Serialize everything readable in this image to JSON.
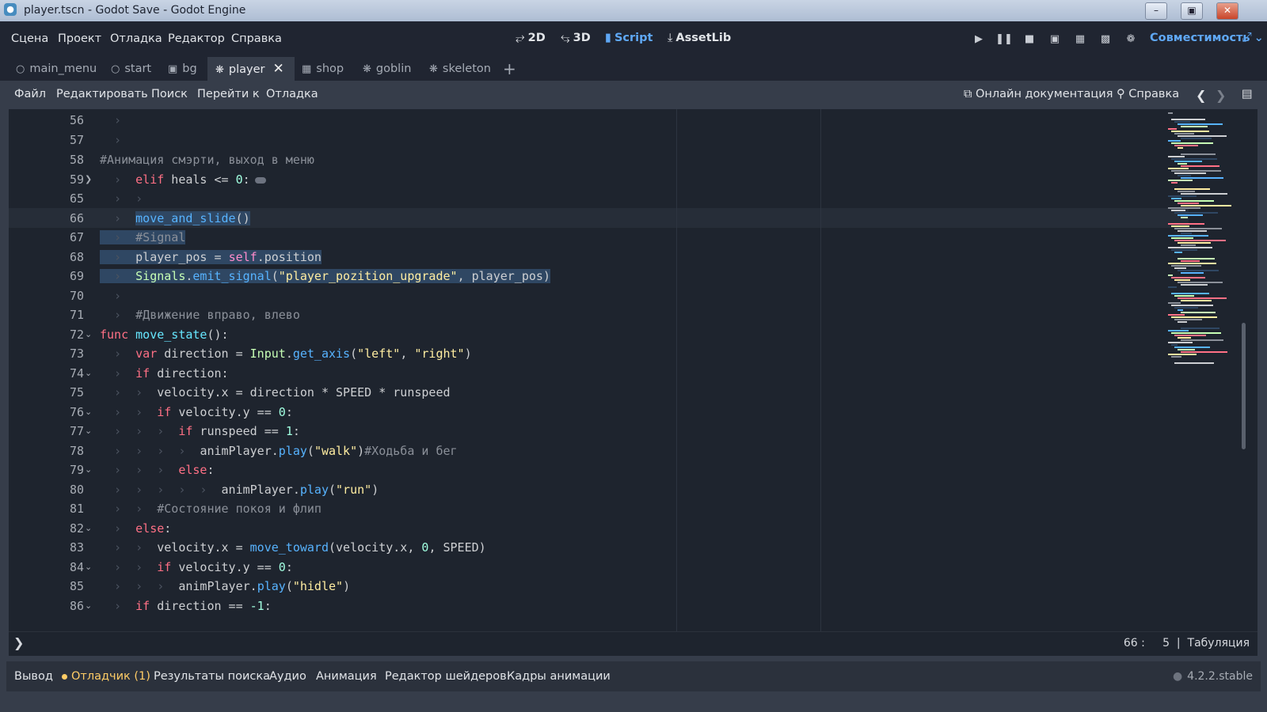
{
  "window": {
    "title": "player.tscn - Godot Save - Godot Engine",
    "controls": [
      "–",
      "▣",
      "✕"
    ]
  },
  "main_menu": [
    "Сцена",
    "Проект",
    "Отладка",
    "Редактор",
    "Справка"
  ],
  "modes": [
    {
      "label": "2D",
      "icon": "2d-icon"
    },
    {
      "label": "3D",
      "icon": "3d-icon"
    },
    {
      "label": "Script",
      "icon": "script-icon",
      "active": true
    },
    {
      "label": "AssetLib",
      "icon": "assetlib-icon"
    }
  ],
  "run_controls": [
    "play-icon",
    "pause-icon",
    "stop-icon",
    "remote-debug-icon",
    "play-scene-icon",
    "play-custom-scene-icon",
    "movie-maker-icon"
  ],
  "renderer": "Совместимость",
  "scene_tabs": [
    {
      "label": "main_menu",
      "icon": "node-icon"
    },
    {
      "label": "start",
      "icon": "node-icon"
    },
    {
      "label": "bg",
      "icon": "control-icon"
    },
    {
      "label": "player",
      "icon": "character-icon",
      "active": true
    },
    {
      "label": "shop",
      "icon": "frame-icon"
    },
    {
      "label": "goblin",
      "icon": "character-icon"
    },
    {
      "label": "skeleton",
      "icon": "character-icon"
    }
  ],
  "script_menu": [
    "Файл",
    "Редактировать",
    "Поиск",
    "Перейти к",
    "Отладка"
  ],
  "online_docs": "Онлайн документация",
  "help": "Справка",
  "code_lines": [
    {
      "n": "56"
    },
    {
      "n": "57"
    },
    {
      "n": "58"
    },
    {
      "n": "59",
      "fold": "›"
    },
    {
      "n": "65"
    },
    {
      "n": "66"
    },
    {
      "n": "67"
    },
    {
      "n": "68"
    },
    {
      "n": "69"
    },
    {
      "n": "70"
    },
    {
      "n": "71"
    },
    {
      "n": "72",
      "fold": "⌄"
    },
    {
      "n": "73"
    },
    {
      "n": "74",
      "fold": "⌄"
    },
    {
      "n": "75"
    },
    {
      "n": "76",
      "fold": "⌄"
    },
    {
      "n": "77",
      "fold": "⌄"
    },
    {
      "n": "78"
    },
    {
      "n": "79",
      "fold": "⌄"
    },
    {
      "n": "80"
    },
    {
      "n": "81"
    },
    {
      "n": "82",
      "fold": "⌄"
    },
    {
      "n": "83"
    },
    {
      "n": "84",
      "fold": "⌄"
    },
    {
      "n": "85"
    },
    {
      "n": "86",
      "fold": "⌄"
    }
  ],
  "code": {
    "c58": "#Анимация смэрти, выход в меню",
    "elif": "elif",
    "heals_cond": " heals <= ",
    "zero": "0",
    "colon": ":",
    "move_and_slide": "move_and_slide",
    "parens": "()",
    "signal_comment": "#Signal",
    "player_pos_assign": "player_pos = ",
    "self": "self",
    "dot_position": ".position",
    "signals": "Signals",
    "dot": ".",
    "emit_signal": "emit_signal",
    "open": "(",
    "sig_name": "\"player_pozition_upgrade\"",
    "sig_args": ", player_pos)",
    "c71": "#Движение вправо, влево",
    "func": "func",
    "move_state": "move_state",
    "func_tail": "():",
    "var": "var",
    "direction_assign": " direction = ",
    "input": "Input",
    "get_axis": "get_axis",
    "left": "\"left\"",
    "comma": ", ",
    "right": "\"right\"",
    "close": ")",
    "if": "if",
    "direction_colon": " direction:",
    "vel_x_assign": "velocity.x = direction * SPEED * runspeed",
    "vel_y_eq": " velocity.y == ",
    "runspeed_eq": " runspeed == ",
    "one": "1",
    "anim_player": "animPlayer",
    "play": "play",
    "walk": "\"walk\"",
    "walk_comment": "#Ходьба и бег",
    "else": "else",
    "run": "\"run\"",
    "c81": "#Состояние покоя и флип",
    "vel_x_is": "velocity.x = ",
    "move_toward": "move_toward",
    "mt_args1": "(velocity.x, ",
    "mt_args2": ", SPEED)",
    "hidle": "\"hidle\"",
    "dir_eq": " direction == ",
    "neg_one": "-1"
  },
  "status": {
    "line": "66",
    "col": "5",
    "indent": "Табуляция"
  },
  "bottom_tabs": [
    "Вывод",
    "Отладчик (1)",
    "Результаты поиска",
    "Аудио",
    "Анимация",
    "Редактор шейдеров",
    "Кадры анимации"
  ],
  "version": "4.2.2.stable",
  "colors": {
    "accent": "#5fa8f5",
    "keyword": "#ff7085",
    "function": "#57b3ff",
    "string": "#ffeda1",
    "comment": "#8b9099",
    "selection": "#2f4763",
    "warning": "#ffcc66"
  }
}
